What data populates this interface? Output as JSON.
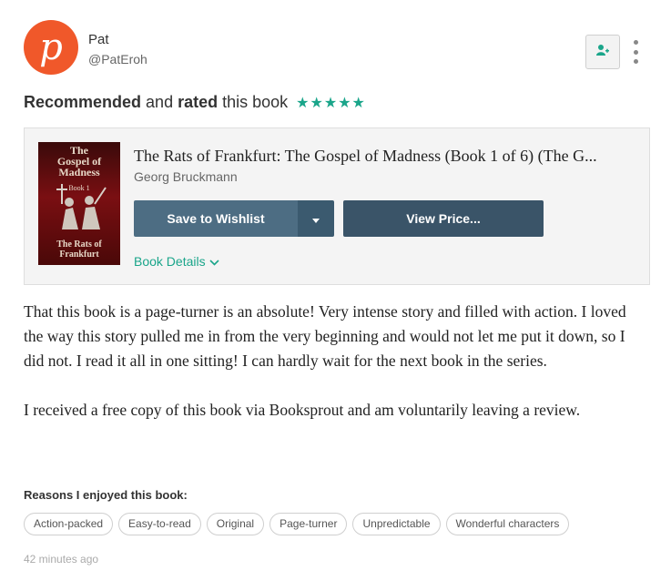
{
  "user": {
    "avatar_letter": "p",
    "name": "Pat",
    "handle": "@PatEroh"
  },
  "headline": {
    "part1": "Recommended",
    "part2": " and ",
    "part3": "rated",
    "part4": " this book",
    "stars": "★★★★★",
    "rating": 5
  },
  "book": {
    "title": "The Rats of Frankfurt: The Gospel of Madness (Book 1 of 6) (The G...",
    "author": "Georg Bruckmann",
    "cover": {
      "title_line1": "The",
      "title_line2": "Gospel of Madness",
      "subtitle": "Book 1",
      "footer": "The Rats of Frankfurt"
    },
    "wishlist_label": "Save to Wishlist",
    "price_label": "View Price...",
    "details_label": "Book Details"
  },
  "review": {
    "paragraph1": "That this book is a page-turner is an absolute! Very intense story and filled with action. I loved the way this story pulled me in from the very beginning and would not let me put it down, so I did not. I read it all in one sitting! I can hardly wait for the next book in the series.",
    "paragraph2": "I received a free copy of this book via Booksprout and am voluntarily leaving a review."
  },
  "reasons": {
    "title": "Reasons I enjoyed this book:",
    "tags": [
      "Action-packed",
      "Easy-to-read",
      "Original",
      "Page-turner",
      "Unpredictable",
      "Wonderful characters"
    ]
  },
  "timestamp": "42 minutes ago",
  "colors": {
    "accent": "#1aa58a",
    "avatar": "#f0582a",
    "button": "#4d6d83",
    "button_dark": "#3a5468"
  },
  "icons": {
    "follow": "add-user-icon",
    "more": "more-vertical-icon",
    "dropdown": "caret-down-icon",
    "details": "chevron-down-icon"
  }
}
